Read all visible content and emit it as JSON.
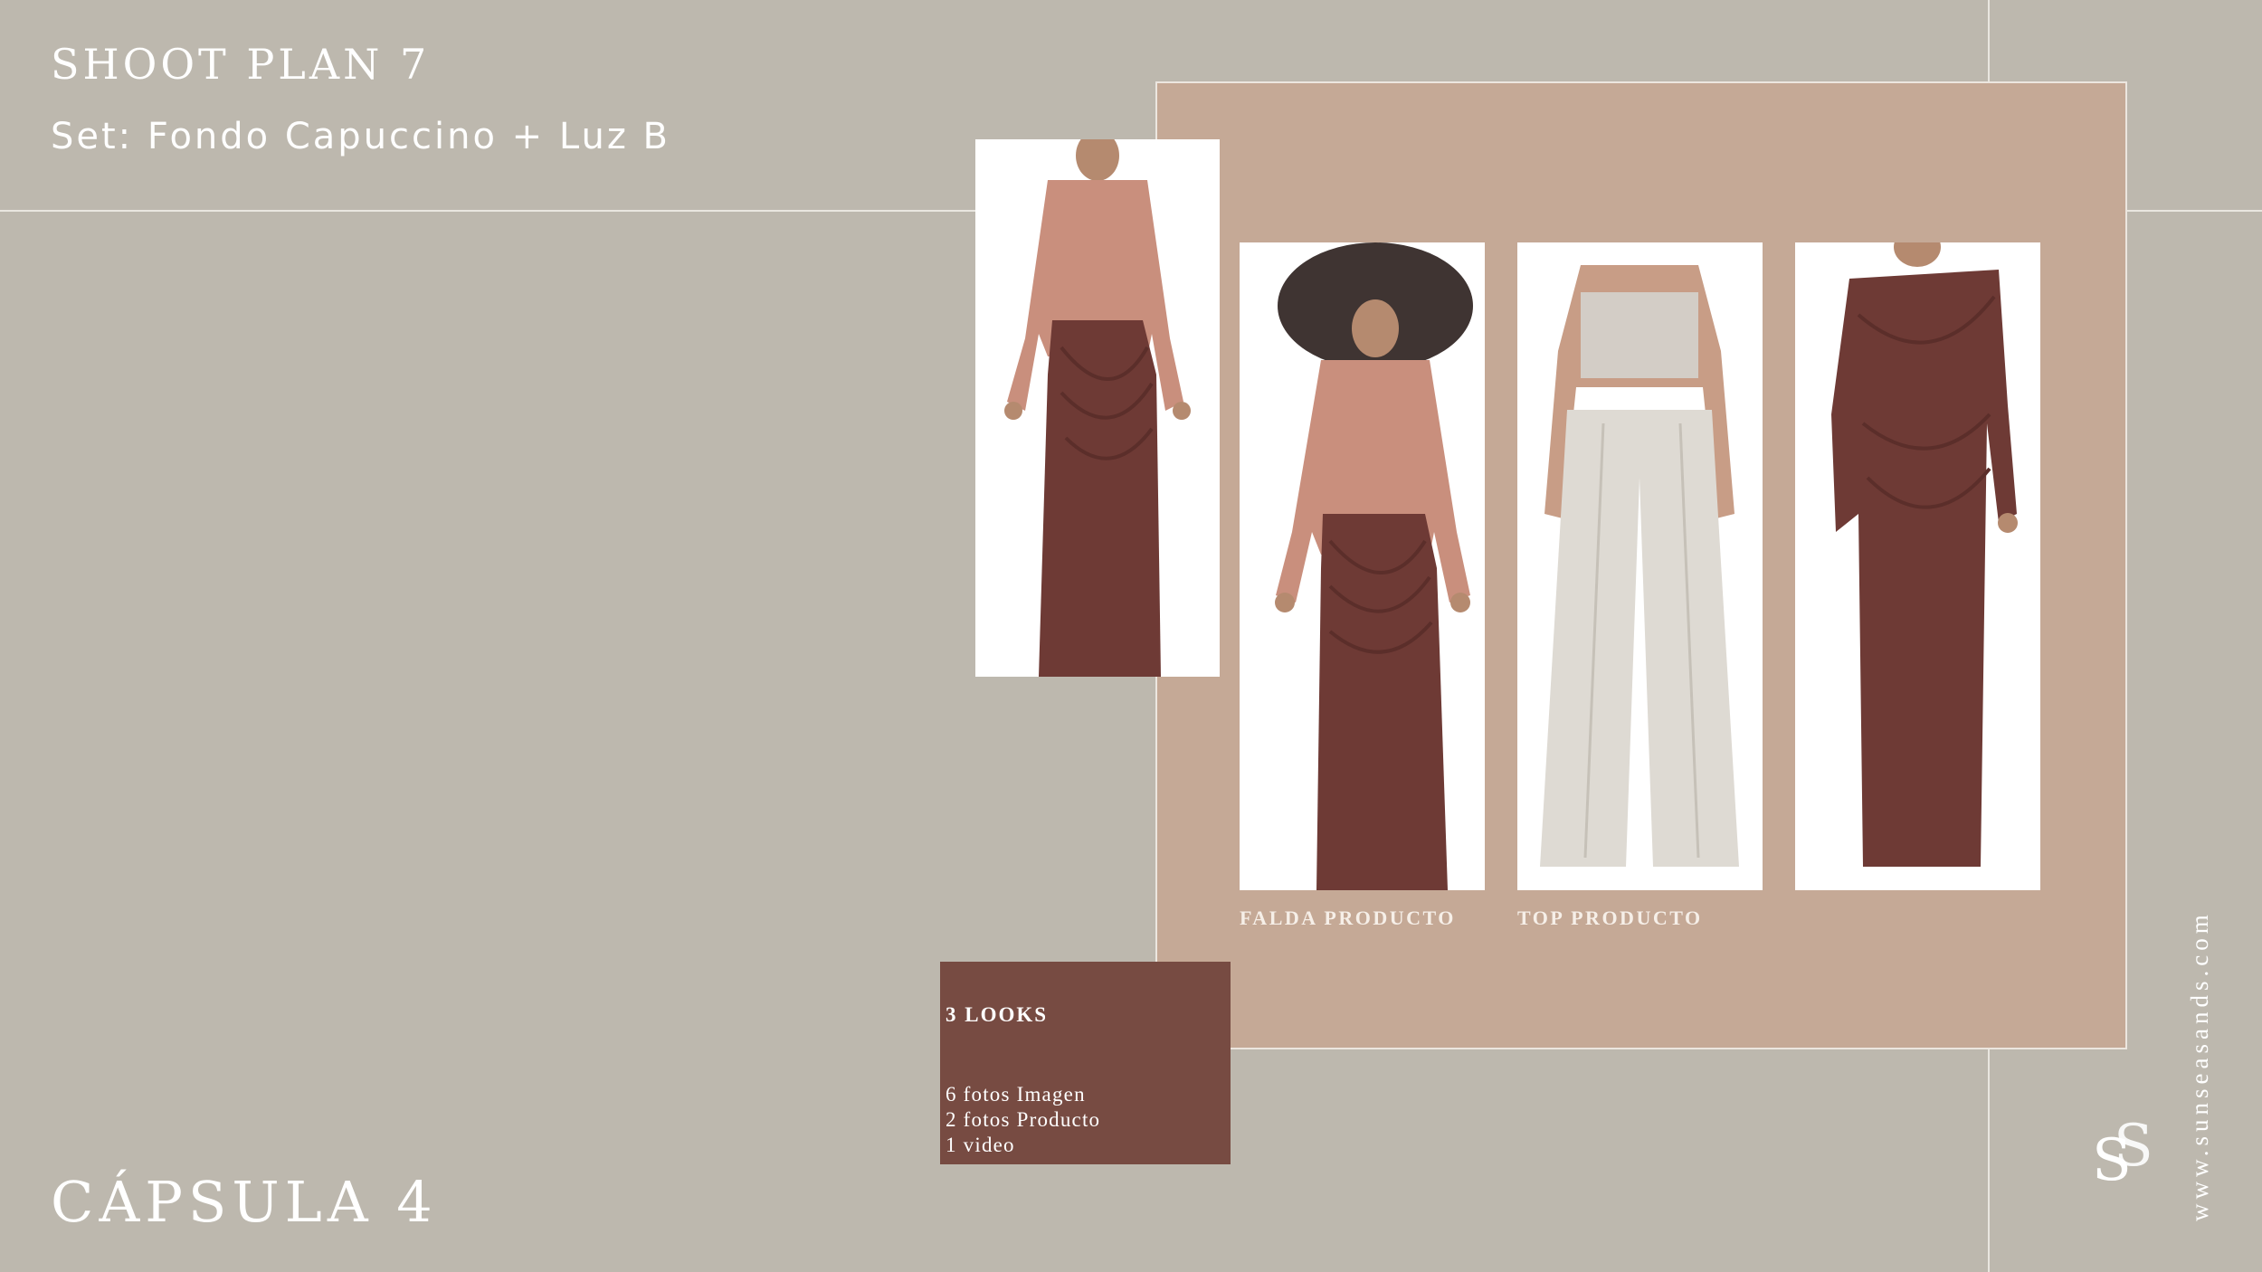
{
  "header": {
    "title": "SHOOT PLAN 7",
    "subtitle": "Set: Fondo Capuccino + Luz B"
  },
  "footer": {
    "capsule": "CÁPSULA 4"
  },
  "photos": [
    {
      "name": "look-pink-shirt-draped-skirt",
      "caption": ""
    },
    {
      "name": "look-hat-pink-shirt-draped-skirt",
      "caption": "FALDA PRODUCTO"
    },
    {
      "name": "look-bandeau-top-wide-trousers",
      "caption": "TOP PRODUCTO"
    },
    {
      "name": "look-one-shoulder-draped-dress",
      "caption": ""
    }
  ],
  "looks_box": {
    "title": "3 LOOKS",
    "items": [
      "6 fotos Imagen",
      "2 fotos Producto",
      "1 video"
    ]
  },
  "brand": {
    "website": "www.sunseasands.com",
    "logo_icon": "ss-monogram-logo"
  },
  "colors": {
    "background": "#bdb8ae",
    "panel": "#c5a996",
    "looks_box": "#774b42",
    "accent_garment": "#6e3a35",
    "shirt": "#c98f7d"
  }
}
